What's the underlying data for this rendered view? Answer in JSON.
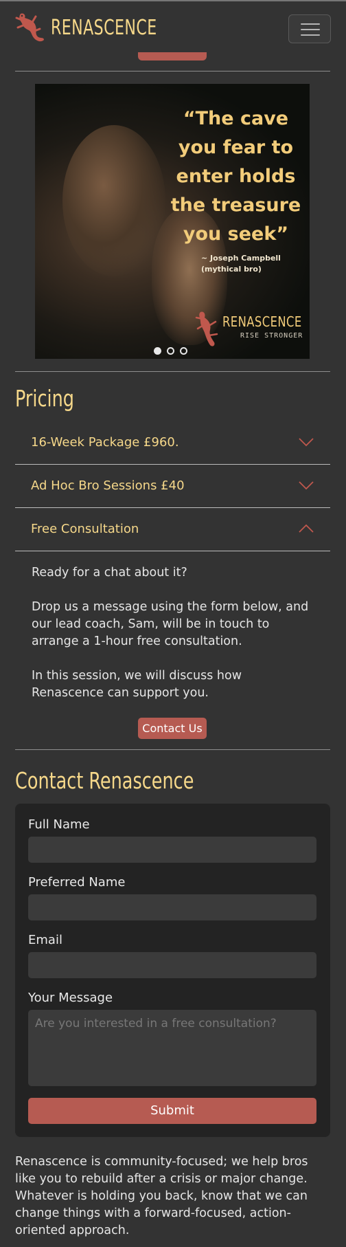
{
  "brand": {
    "name": "RENASCENCE"
  },
  "nav": {
    "menu_icon": "hamburger-icon"
  },
  "carousel": {
    "quote": "“The cave you fear to enter holds the treasure you seek”",
    "attribution_line1": "~ Joseph Campbell",
    "attribution_line2": "(mythical bro)",
    "logo_name": "RENASCENCE",
    "logo_tagline": "RISE STRONGER",
    "slide_count": 3,
    "active_slide": 1
  },
  "pricing": {
    "heading": "Pricing",
    "items": [
      {
        "label": "16-Week Package £960.",
        "expanded": false
      },
      {
        "label": "Ad Hoc Bro Sessions £40",
        "expanded": false
      },
      {
        "label": "Free Consultation",
        "expanded": true
      }
    ],
    "consultation": {
      "p1": "Ready for a chat about it?",
      "p2": "Drop us a message using the form below, and our lead coach, Sam, will be in touch to arrange a 1-hour free consultation.",
      "p3": "In this session, we will discuss how Renascence can support you.",
      "button": "Contact Us"
    }
  },
  "contact": {
    "heading": "Contact Renascence",
    "fields": {
      "full_name": {
        "label": "Full Name",
        "value": ""
      },
      "preferred_name": {
        "label": "Preferred Name",
        "value": ""
      },
      "email": {
        "label": "Email",
        "value": ""
      },
      "message": {
        "label": "Your Message",
        "placeholder": "Are you interested in a free consultation?"
      }
    },
    "submit": "Submit"
  },
  "footer": {
    "text": "Renascence is community-focused; we help bros like you to rebuild after a crisis or major change. Whatever is holding you back, know that we can change things with a forward-focused, action-oriented approach."
  },
  "colors": {
    "background": "#333333",
    "accent_gold": "#f6d88a",
    "accent_red": "#b65b52",
    "form_bg": "#232323",
    "input_bg": "#3b3b3b"
  }
}
